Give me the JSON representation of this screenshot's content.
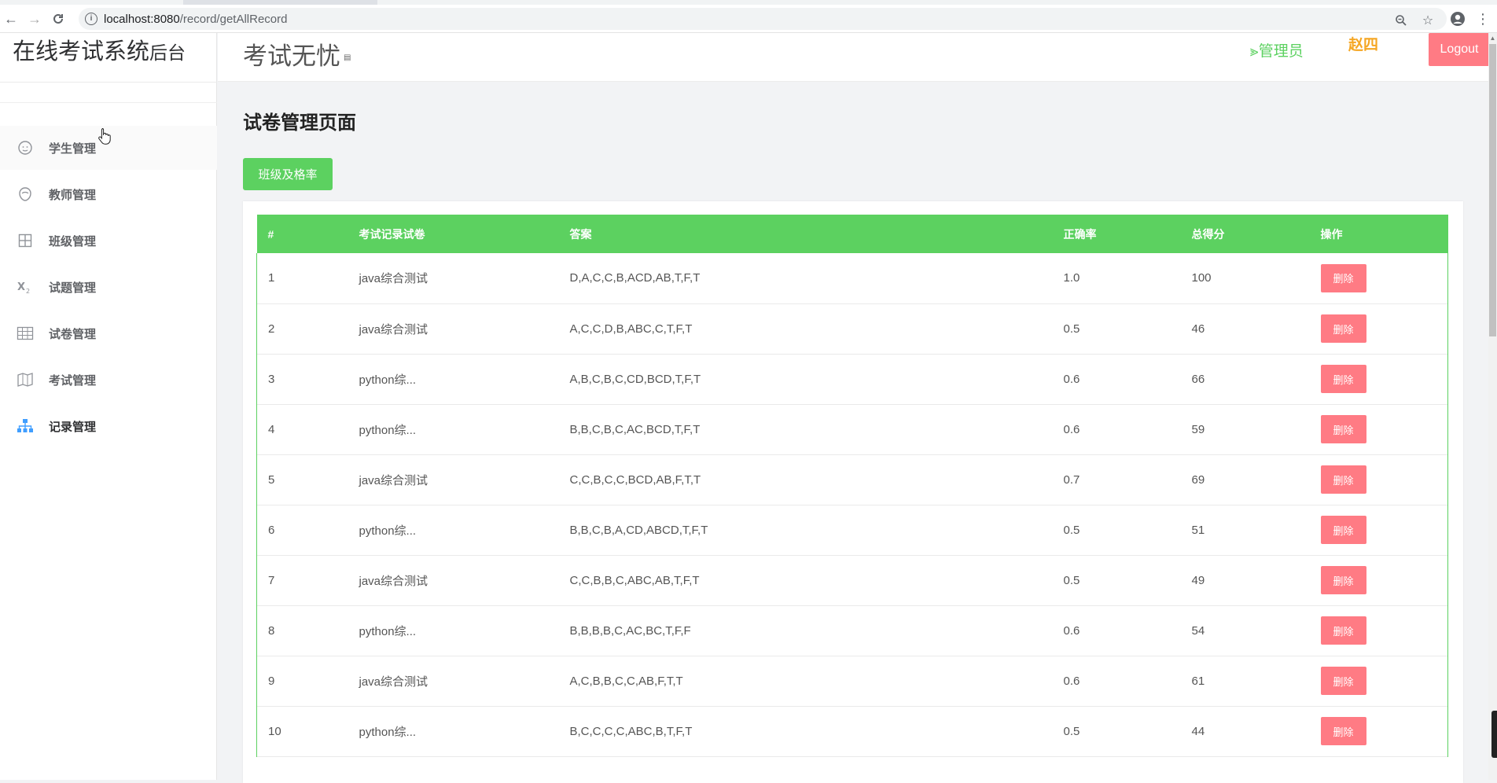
{
  "browser": {
    "url_host": "localhost:8080",
    "url_path": "/record/getAllRecord"
  },
  "sidebar": {
    "brand_main": "在线考试系统",
    "brand_suffix": "后台",
    "items": [
      {
        "label": "学生管理",
        "icon": "student-icon"
      },
      {
        "label": "教师管理",
        "icon": "teacher-icon"
      },
      {
        "label": "班级管理",
        "icon": "grid-icon"
      },
      {
        "label": "试题管理",
        "icon": "formula-icon"
      },
      {
        "label": "试卷管理",
        "icon": "table-icon"
      },
      {
        "label": "考试管理",
        "icon": "map-icon"
      },
      {
        "label": "记录管理",
        "icon": "org-chart-icon"
      }
    ]
  },
  "header": {
    "site_title": "考试无忧",
    "role": "管理员",
    "username": "赵四",
    "logout_label": "Logout"
  },
  "main": {
    "page_title": "试卷管理页面",
    "class_button_label": "班级及格率",
    "table": {
      "columns": [
        "#",
        "考试记录试卷",
        "答案",
        "正确率",
        "总得分",
        "操作"
      ],
      "delete_label": "删除",
      "rows": [
        {
          "id": "1",
          "paper": "java综合测试",
          "answer": "D,A,C,C,B,ACD,AB,T,F,T",
          "rate": "1.0",
          "score": "100"
        },
        {
          "id": "2",
          "paper": "java综合测试",
          "answer": "A,C,C,D,B,ABC,C,T,F,T",
          "rate": "0.5",
          "score": "46"
        },
        {
          "id": "3",
          "paper": "python综...",
          "answer": "A,B,C,B,C,CD,BCD,T,F,T",
          "rate": "0.6",
          "score": "66"
        },
        {
          "id": "4",
          "paper": "python综...",
          "answer": "B,B,C,B,C,AC,BCD,T,F,T",
          "rate": "0.6",
          "score": "59"
        },
        {
          "id": "5",
          "paper": "java综合测试",
          "answer": "C,C,B,C,C,BCD,AB,F,T,T",
          "rate": "0.7",
          "score": "69"
        },
        {
          "id": "6",
          "paper": "python综...",
          "answer": "B,B,C,B,A,CD,ABCD,T,F,T",
          "rate": "0.5",
          "score": "51"
        },
        {
          "id": "7",
          "paper": "java综合测试",
          "answer": "C,C,B,B,C,ABC,AB,T,F,T",
          "rate": "0.5",
          "score": "49"
        },
        {
          "id": "8",
          "paper": "python综...",
          "answer": "B,B,B,B,C,AC,BC,T,F,F",
          "rate": "0.6",
          "score": "54"
        },
        {
          "id": "9",
          "paper": "java综合测试",
          "answer": "A,C,B,B,C,C,AB,F,T,T",
          "rate": "0.6",
          "score": "61"
        },
        {
          "id": "10",
          "paper": "python综...",
          "answer": "B,C,C,C,C,ABC,B,T,F,T",
          "rate": "0.5",
          "score": "44"
        }
      ]
    }
  }
}
